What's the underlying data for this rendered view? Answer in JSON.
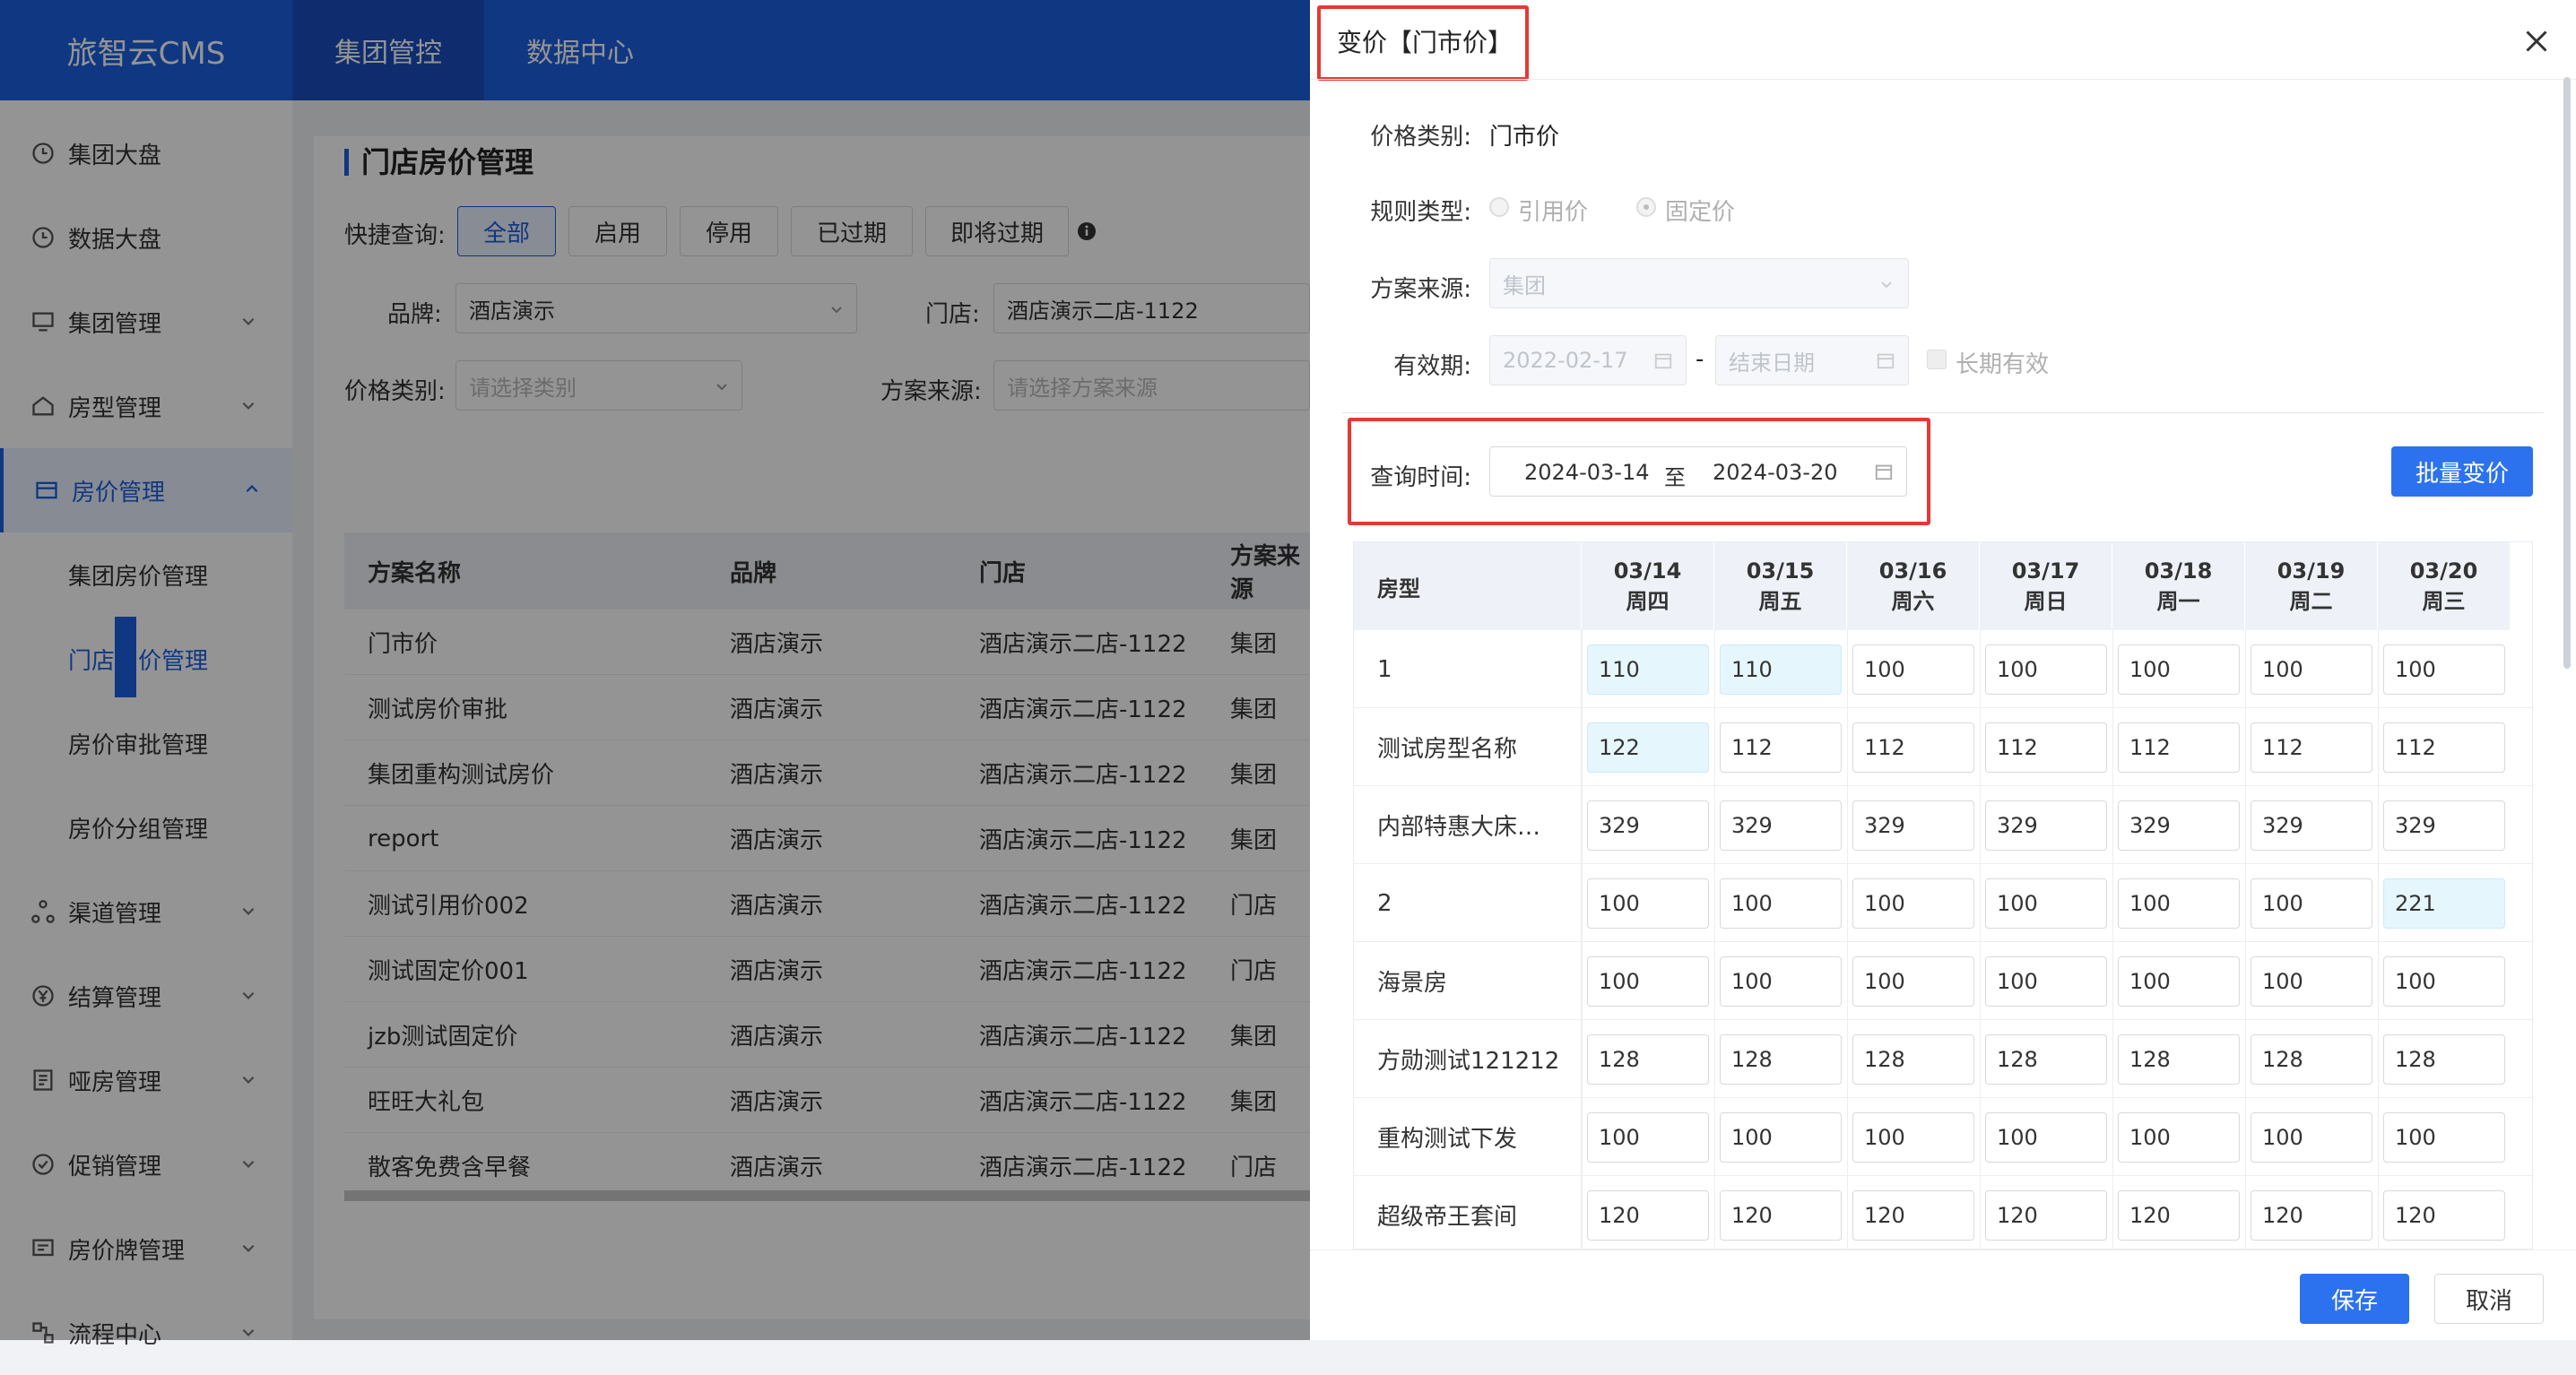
{
  "app": {
    "logo": "旅智云CMS",
    "top_tabs": [
      "集团管控",
      "数据中心"
    ]
  },
  "sidebar": {
    "items": [
      {
        "label": "集团大盘",
        "icon": "clock-icon"
      },
      {
        "label": "数据大盘",
        "icon": "clock-icon"
      },
      {
        "label": "集团管理",
        "icon": "monitor-icon"
      },
      {
        "label": "房型管理",
        "icon": "home-icon"
      },
      {
        "label": "房价管理",
        "icon": "card-icon"
      },
      {
        "label": "渠道管理",
        "icon": "share-icon"
      },
      {
        "label": "结算管理",
        "icon": "yen-icon"
      },
      {
        "label": "哑房管理",
        "icon": "list-icon"
      },
      {
        "label": "促销管理",
        "icon": "badge-icon"
      },
      {
        "label": "房价牌管理",
        "icon": "board-icon"
      },
      {
        "label": "流程中心",
        "icon": "flow-icon"
      }
    ],
    "sub_items": [
      "集团房价管理",
      "门店房价管理",
      "房价审批管理",
      "房价分组管理"
    ]
  },
  "main": {
    "title": "门店房价管理",
    "quick_query_label": "快捷查询:",
    "quick_buttons": [
      "全部",
      "启用",
      "停用",
      "已过期",
      "即将过期"
    ],
    "brand_label": "品牌:",
    "brand_value": "酒店演示",
    "store_label": "门店:",
    "store_value": "酒店演示二店-1122",
    "price_type_label": "价格类别:",
    "price_type_placeholder": "请选择类别",
    "source_label": "方案来源:",
    "source_placeholder": "请选择方案来源",
    "table": {
      "headers": [
        "方案名称",
        "品牌",
        "门店",
        "方案来源"
      ],
      "rows": [
        [
          "门市价",
          "酒店演示",
          "酒店演示二店-1122",
          "集团"
        ],
        [
          "测试房价审批",
          "酒店演示",
          "酒店演示二店-1122",
          "集团"
        ],
        [
          "集团重构测试房价",
          "酒店演示",
          "酒店演示二店-1122",
          "集团"
        ],
        [
          "report",
          "酒店演示",
          "酒店演示二店-1122",
          "集团"
        ],
        [
          "测试引用价002",
          "酒店演示",
          "酒店演示二店-1122",
          "门店"
        ],
        [
          "测试固定价001",
          "酒店演示",
          "酒店演示二店-1122",
          "门店"
        ],
        [
          "jzb测试固定价",
          "酒店演示",
          "酒店演示二店-1122",
          "集团"
        ],
        [
          "旺旺大礼包",
          "酒店演示",
          "酒店演示二店-1122",
          "集团"
        ],
        [
          "散客免费含早餐",
          "酒店演示",
          "酒店演示二店-1122",
          "门店"
        ]
      ]
    }
  },
  "drawer": {
    "title": "变价【门市价】",
    "price_category_label": "价格类别:",
    "price_category_value": "门市价",
    "rule_type_label": "规则类型:",
    "rule_options": [
      "引用价",
      "固定价"
    ],
    "rule_selected": "固定价",
    "source_label": "方案来源:",
    "source_value": "集团",
    "validity_label": "有效期:",
    "validity_start": "2022-02-17",
    "validity_end_placeholder": "结束日期",
    "long_term_label": "长期有效",
    "query_time_label": "查询时间:",
    "query_start": "2024-03-14",
    "query_to": "至",
    "query_end": "2024-03-20",
    "batch_button": "批量变价",
    "grid": {
      "room_header": "房型",
      "dates": [
        {
          "date": "03/14",
          "weekday": "周四"
        },
        {
          "date": "03/15",
          "weekday": "周五"
        },
        {
          "date": "03/16",
          "weekday": "周六"
        },
        {
          "date": "03/17",
          "weekday": "周日"
        },
        {
          "date": "03/18",
          "weekday": "周一"
        },
        {
          "date": "03/19",
          "weekday": "周二"
        },
        {
          "date": "03/20",
          "weekday": "周三"
        }
      ],
      "rows": [
        {
          "name": "1",
          "prices": [
            "110",
            "110",
            "100",
            "100",
            "100",
            "100",
            "100"
          ],
          "highlight": [
            0,
            1
          ]
        },
        {
          "name": "测试房型名称",
          "prices": [
            "122",
            "112",
            "112",
            "112",
            "112",
            "112",
            "112"
          ],
          "highlight": [
            0
          ]
        },
        {
          "name": "内部特惠大床…",
          "prices": [
            "329",
            "329",
            "329",
            "329",
            "329",
            "329",
            "329"
          ],
          "highlight": []
        },
        {
          "name": "2",
          "prices": [
            "100",
            "100",
            "100",
            "100",
            "100",
            "100",
            "221"
          ],
          "highlight": [
            6
          ]
        },
        {
          "name": "海景房",
          "prices": [
            "100",
            "100",
            "100",
            "100",
            "100",
            "100",
            "100"
          ],
          "highlight": []
        },
        {
          "name": "方勋测试121212",
          "prices": [
            "128",
            "128",
            "128",
            "128",
            "128",
            "128",
            "128"
          ],
          "highlight": []
        },
        {
          "name": "重构测试下发",
          "prices": [
            "100",
            "100",
            "100",
            "100",
            "100",
            "100",
            "100"
          ],
          "highlight": []
        },
        {
          "name": "超级帝王套间",
          "prices": [
            "120",
            "120",
            "120",
            "120",
            "120",
            "120",
            "120"
          ],
          "highlight": []
        }
      ]
    },
    "save_button": "保存",
    "cancel_button": "取消"
  },
  "colors": {
    "primary": "#1d5fe0",
    "button": "#2c72ee",
    "highlight_cell": "#e6f6fd",
    "annotation_red": "#e53935"
  }
}
